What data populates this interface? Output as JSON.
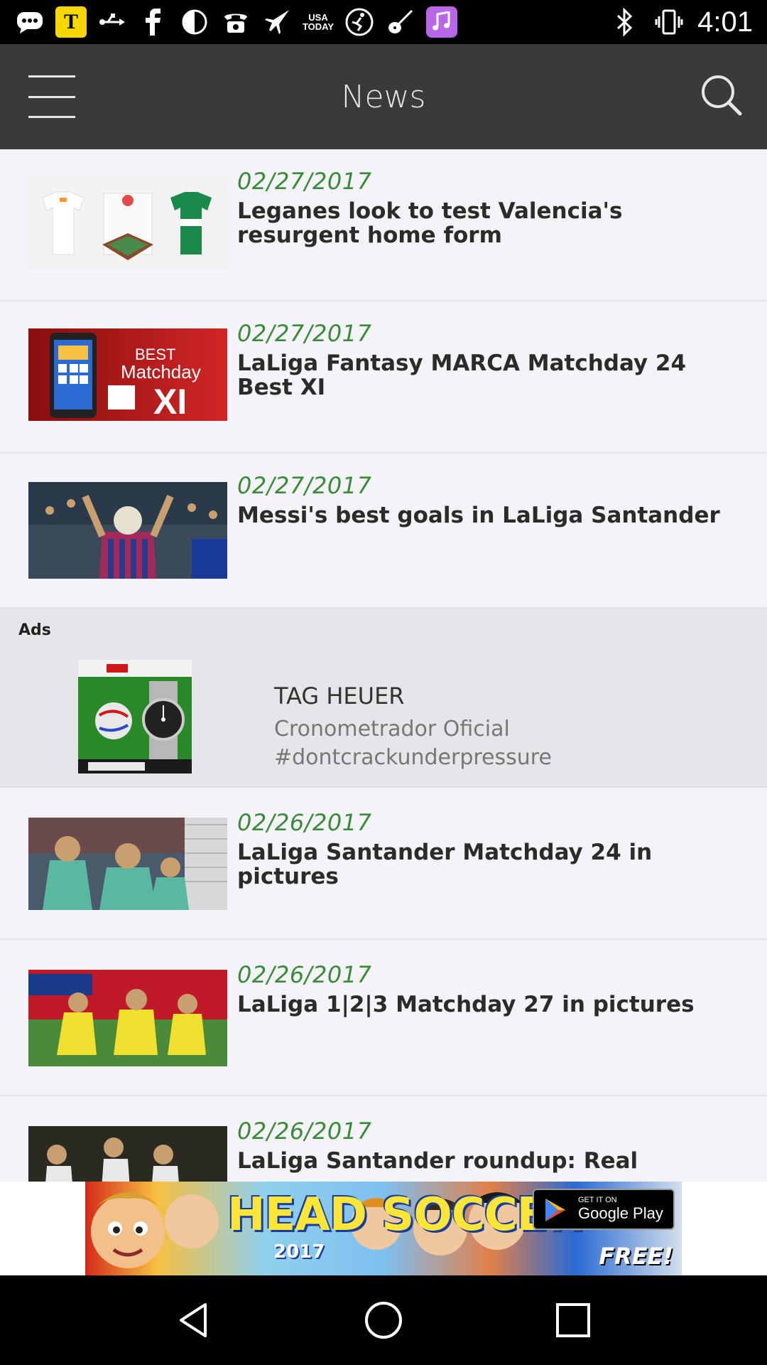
{
  "status_bar": {
    "time": "4:01",
    "icons": [
      "chat-icon",
      "t-app-icon",
      "usb-icon",
      "facebook-icon",
      "half-moon-icon",
      "telephone-icon",
      "plane-icon",
      "usa-today-icon",
      "soccer-player-icon",
      "guitar-icon",
      "music-app-icon",
      "bluetooth-icon",
      "vibrate-icon"
    ],
    "usa_today_text": "USA TODAY",
    "t_text": "T"
  },
  "app_bar": {
    "title": "News",
    "background": "#3a3a3a"
  },
  "news": [
    {
      "date": "02/27/2017",
      "title": "Leganes look to test Valencia's resurgent home form"
    },
    {
      "date": "02/27/2017",
      "title": "LaLiga Fantasy MARCA Matchday 24 Best XI"
    },
    {
      "date": "02/27/2017",
      "title": "Messi's best goals in LaLiga Santander"
    },
    {
      "date": "02/26/2017",
      "title": "LaLiga Santander Matchday 24 in pictures"
    },
    {
      "date": "02/26/2017",
      "title": "LaLiga 1|2|3 Matchday 27 in pictures"
    },
    {
      "date": "02/26/2017",
      "title": "LaLiga Santander roundup: Real"
    }
  ],
  "ads": {
    "label": "Ads",
    "brand": "TAG HEUER",
    "description": "Cronometrador Oficial #dontcrackunderpressure"
  },
  "banner": {
    "title": "HEAD SOCCER",
    "year": "2017",
    "store_small": "GET IT ON",
    "store_big": "Google Play",
    "cta": "FREE!"
  },
  "colors": {
    "date_green": "#3a8a3a",
    "list_background": "#f4f4f8",
    "ad_background": "#e6e6ea"
  }
}
